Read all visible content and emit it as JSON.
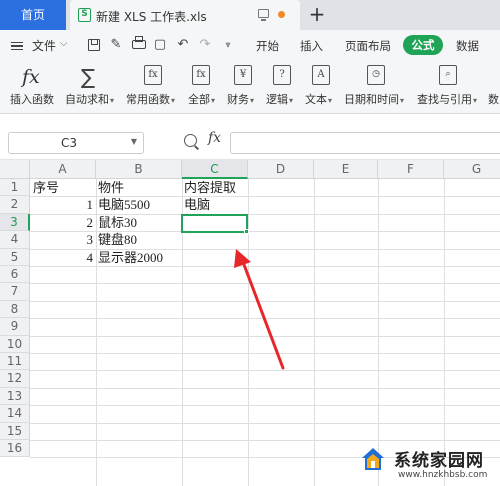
{
  "tabbar": {
    "home_tab": "首页",
    "doc_tab_icon_text": "S",
    "doc_tab_title": "新建 XLS 工作表.xls",
    "new_tab_symbol": "+"
  },
  "menubar": {
    "file_label": "文件",
    "tabs": [
      "开始",
      "插入",
      "页面布局",
      "公式",
      "数据"
    ],
    "active_tab": "公式",
    "active_color": "#1fa356"
  },
  "ribbon": {
    "items": [
      {
        "label": "插入函数",
        "icon": "fx-icon",
        "has_dropdown": false
      },
      {
        "label": "自动求和",
        "icon": "sigma-icon",
        "has_dropdown": true
      },
      {
        "label": "常用函数",
        "icon": "common-fx-icon",
        "has_dropdown": true
      },
      {
        "label": "全部",
        "icon": "all-fx-icon",
        "has_dropdown": true
      },
      {
        "label": "财务",
        "icon": "finance-icon",
        "has_dropdown": true
      },
      {
        "label": "逻辑",
        "icon": "logic-icon",
        "has_dropdown": true
      },
      {
        "label": "文本",
        "icon": "text-icon",
        "has_dropdown": true
      },
      {
        "label": "日期和时间",
        "icon": "datetime-icon",
        "has_dropdown": true
      },
      {
        "label": "查找与引用",
        "icon": "lookup-icon",
        "has_dropdown": true
      },
      {
        "label": "数",
        "icon": "math-icon",
        "has_dropdown": false
      }
    ],
    "icon_glyphs": {
      "fx": "fx",
      "sigma": "∑",
      "finance": "¥",
      "logic": "?",
      "text": "A"
    }
  },
  "formulabar": {
    "name_box": "C3",
    "fx_label": "fx",
    "formula_value": ""
  },
  "grid": {
    "columns": [
      "A",
      "B",
      "C",
      "D",
      "E",
      "F",
      "G"
    ],
    "selected_column": "C",
    "rows": [
      "1",
      "2",
      "3",
      "4",
      "5",
      "6",
      "7",
      "8",
      "9",
      "10",
      "11",
      "12",
      "13",
      "14",
      "15",
      "16"
    ],
    "selected_row": "3",
    "active_cell": "C3",
    "cells": {
      "A1": "序号",
      "B1": "物件",
      "C1": "内容提取",
      "A2": "1",
      "B2": "电脑5500",
      "C2": "电脑",
      "A3": "2",
      "B3": "鼠标30",
      "A4": "3",
      "B4": "键盘80",
      "A5": "4",
      "B5": "显示器2000"
    },
    "annotation_arrow_color": "#e8262a"
  },
  "watermark": {
    "title": "系统家园网",
    "url": "www.hnzkhbsb.com"
  }
}
